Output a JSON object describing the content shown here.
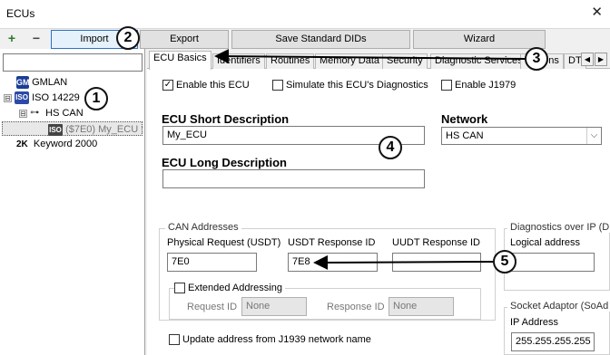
{
  "window": {
    "title": "ECUs",
    "close_glyph": "✕"
  },
  "toolbar": {
    "add_glyph": "+",
    "remove_glyph": "−",
    "import_label": "Import",
    "export_label": "Export",
    "save_dids_label": "Save Standard DIDs",
    "wizard_label": "Wizard"
  },
  "tree": {
    "gmlan": {
      "icon_text": "GM",
      "label": "GMLAN"
    },
    "iso": {
      "expander": "⊟",
      "icon_text": "ISO",
      "label": "ISO 14229"
    },
    "hscan": {
      "expander": "⊟",
      "icon": "network-icon",
      "label": "HS CAN"
    },
    "ecu": {
      "icon_text": "ISO",
      "label": "($7E0) My_ECU ;"
    },
    "kw": {
      "icon_text": "2K",
      "label": "Keyword 2000"
    }
  },
  "tabs": [
    "ECU Basics",
    "Identifiers",
    "Routines",
    "Memory Data",
    "Security",
    "Diagnostic Services",
    "Options",
    "DT"
  ],
  "tab_nav": {
    "left": "◀",
    "right": "▶"
  },
  "ecu_basics": {
    "enable_ecu": {
      "label": "Enable this ECU",
      "checked": true,
      "mark": "✓"
    },
    "simulate": {
      "label": "Simulate this ECU's Diagnostics",
      "checked": false
    },
    "enable_j1979": {
      "label": "Enable J1979",
      "checked": false
    },
    "short_desc_label": "ECU Short Description",
    "short_desc_value": "My_ECU",
    "network_label": "Network",
    "network_value": "HS CAN",
    "long_desc_label": "ECU Long Description",
    "long_desc_value": "",
    "can": {
      "legend": "CAN Addresses",
      "phys_label": "Physical Request  (USDT)",
      "phys_value": "7E0",
      "usdt_label": "USDT Response ID",
      "usdt_value": "7E8",
      "uudt_label": "UUDT Response ID",
      "uudt_value": "",
      "extended": {
        "label": "Extended Addressing",
        "checked": false
      },
      "req_id_label": "Request ID",
      "req_id_value": "None",
      "resp_id_label": "Response ID",
      "resp_id_value": "None",
      "j1939": {
        "label": "Update address from J1939 network name",
        "checked": false
      }
    },
    "doip": {
      "legend": "Diagnostics over IP (D",
      "logical_label": "Logical address",
      "logical_value": ""
    },
    "socket": {
      "legend": "Socket Adaptor (SoAd",
      "ip_label": "IP Address",
      "ip_value": "255.255.255.255"
    }
  },
  "callouts": [
    "1",
    "2",
    "3",
    "4",
    "5"
  ]
}
